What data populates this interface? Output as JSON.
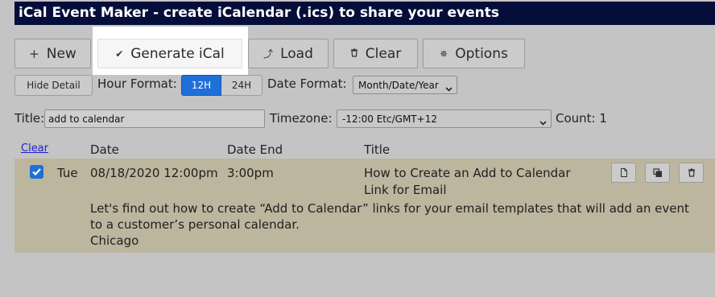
{
  "app": {
    "title": "iCal Event Maker - create iCalendar (.ics) to share your events"
  },
  "toolbar": {
    "new_label": "New",
    "generate_label": "Generate iCal",
    "load_label": "Load",
    "clear_label": "Clear",
    "options_label": "Options"
  },
  "settings": {
    "hide_detail_label": "Hide Detail",
    "hour_format_label": "Hour Format:",
    "hour_12_label": "12H",
    "hour_24_label": "24H",
    "hour_format_selected": "12H",
    "date_format_label": "Date Format:",
    "date_format_value": "Month/Date/Year",
    "title_label": "Title:",
    "title_value": "add to calendar",
    "timezone_label": "Timezone:",
    "timezone_value": "-12:00 Etc/GMT+12",
    "count_label": "Count: 1"
  },
  "table": {
    "clear_link": "Clear",
    "col_date": "Date",
    "col_date_end": "Date End",
    "col_title": "Title"
  },
  "events": [
    {
      "checked": true,
      "weekday": "Tue",
      "date": "08/18/2020 12:00pm",
      "date_end": "3:00pm",
      "title_line1": "How to Create an Add to Calendar",
      "title_line2": "Link for Email",
      "description_line1": "Let's find out how to create “Add to Calendar” links for your email templates that will add an event",
      "description_line2": "to a customer’s personal calendar.",
      "location": "Chicago"
    }
  ],
  "icons": {
    "new": "plus-icon",
    "generate": "checkmark-icon",
    "load": "load-icon",
    "clear": "trash-icon",
    "options": "gear-icon",
    "row_edit": "document-icon",
    "row_copy": "copy-icon",
    "row_delete": "trash-icon"
  },
  "colors": {
    "titlebar_bg": "#050d3a",
    "accent_blue": "#1f6fd8",
    "selected_row_bg": "#bcb69f",
    "page_bg": "#c4c4c4"
  }
}
